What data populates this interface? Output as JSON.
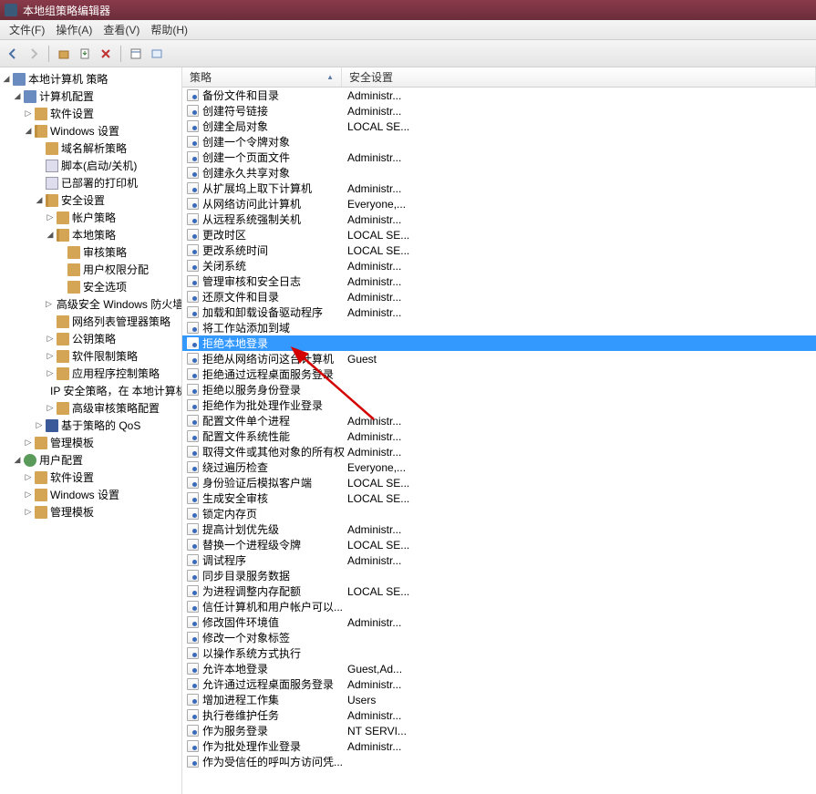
{
  "window": {
    "title": "本地组策略编辑器"
  },
  "menu": {
    "file": "文件(F)",
    "action": "操作(A)",
    "view": "查看(V)",
    "help": "帮助(H)"
  },
  "tree": {
    "root": "本地计算机 策略",
    "computer_config": "计算机配置",
    "software_settings": "软件设置",
    "windows_settings": "Windows 设置",
    "name_res_policy": "域名解析策略",
    "scripts": "脚本(启动/关机)",
    "deployed_printers": "已部署的打印机",
    "security_settings": "安全设置",
    "account_policies": "帐户策略",
    "local_policies": "本地策略",
    "audit_policy": "审核策略",
    "user_rights": "用户权限分配",
    "security_options": "安全选项",
    "adv_firewall": "高级安全 Windows 防火墙",
    "network_list": "网络列表管理器策略",
    "public_key": "公钥策略",
    "software_restrict": "软件限制策略",
    "app_control": "应用程序控制策略",
    "ip_security": "IP 安全策略，在 本地计算机",
    "adv_audit": "高级审核策略配置",
    "policy_qos": "基于策略的 QoS",
    "admin_templates": "管理模板",
    "user_config": "用户配置",
    "software_settings2": "软件设置",
    "windows_settings2": "Windows 设置",
    "admin_templates2": "管理模板"
  },
  "columns": {
    "policy": "策略",
    "setting": "安全设置"
  },
  "selected_index": 16,
  "policies": [
    {
      "name": "备份文件和目录",
      "setting": "Administr..."
    },
    {
      "name": "创建符号链接",
      "setting": "Administr..."
    },
    {
      "name": "创建全局对象",
      "setting": "LOCAL SE..."
    },
    {
      "name": "创建一个令牌对象",
      "setting": ""
    },
    {
      "name": "创建一个页面文件",
      "setting": "Administr..."
    },
    {
      "name": "创建永久共享对象",
      "setting": ""
    },
    {
      "name": "从扩展坞上取下计算机",
      "setting": "Administr..."
    },
    {
      "name": "从网络访问此计算机",
      "setting": "Everyone,..."
    },
    {
      "name": "从远程系统强制关机",
      "setting": "Administr..."
    },
    {
      "name": "更改时区",
      "setting": "LOCAL SE..."
    },
    {
      "name": "更改系统时间",
      "setting": "LOCAL SE..."
    },
    {
      "name": "关闭系统",
      "setting": "Administr..."
    },
    {
      "name": "管理审核和安全日志",
      "setting": "Administr..."
    },
    {
      "name": "还原文件和目录",
      "setting": "Administr..."
    },
    {
      "name": "加载和卸载设备驱动程序",
      "setting": "Administr..."
    },
    {
      "name": "将工作站添加到域",
      "setting": ""
    },
    {
      "name": "拒绝本地登录",
      "setting": ""
    },
    {
      "name": "拒绝从网络访问这台计算机",
      "setting": "Guest"
    },
    {
      "name": "拒绝通过远程桌面服务登录",
      "setting": ""
    },
    {
      "name": "拒绝以服务身份登录",
      "setting": ""
    },
    {
      "name": "拒绝作为批处理作业登录",
      "setting": ""
    },
    {
      "name": "配置文件单个进程",
      "setting": "Administr..."
    },
    {
      "name": "配置文件系统性能",
      "setting": "Administr..."
    },
    {
      "name": "取得文件或其他对象的所有权",
      "setting": "Administr..."
    },
    {
      "name": "绕过遍历检查",
      "setting": "Everyone,..."
    },
    {
      "name": "身份验证后模拟客户端",
      "setting": "LOCAL SE..."
    },
    {
      "name": "生成安全审核",
      "setting": "LOCAL SE..."
    },
    {
      "name": "锁定内存页",
      "setting": ""
    },
    {
      "name": "提高计划优先级",
      "setting": "Administr..."
    },
    {
      "name": "替换一个进程级令牌",
      "setting": "LOCAL SE..."
    },
    {
      "name": "调试程序",
      "setting": "Administr..."
    },
    {
      "name": "同步目录服务数据",
      "setting": ""
    },
    {
      "name": "为进程调整内存配额",
      "setting": "LOCAL SE..."
    },
    {
      "name": "信任计算机和用户帐户可以...",
      "setting": ""
    },
    {
      "name": "修改固件环境值",
      "setting": "Administr..."
    },
    {
      "name": "修改一个对象标签",
      "setting": ""
    },
    {
      "name": "以操作系统方式执行",
      "setting": ""
    },
    {
      "name": "允许本地登录",
      "setting": "Guest,Ad..."
    },
    {
      "name": "允许通过远程桌面服务登录",
      "setting": "Administr..."
    },
    {
      "name": "增加进程工作集",
      "setting": "Users"
    },
    {
      "name": "执行卷维护任务",
      "setting": "Administr..."
    },
    {
      "name": "作为服务登录",
      "setting": "NT SERVI..."
    },
    {
      "name": "作为批处理作业登录",
      "setting": "Administr..."
    },
    {
      "name": "作为受信任的呼叫方访问凭...",
      "setting": ""
    }
  ]
}
